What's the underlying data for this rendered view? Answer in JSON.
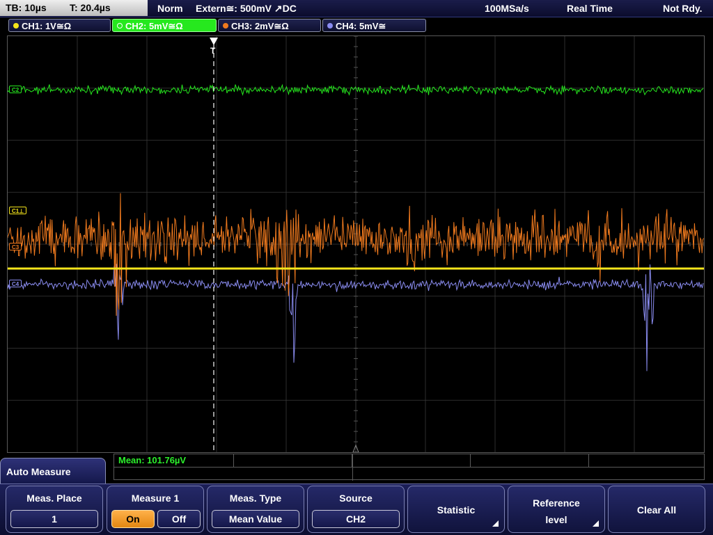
{
  "status": {
    "tb": "TB: 10µs",
    "t": "T: 20.4µs",
    "mode": "Norm",
    "trigger": "Extern≅: 500mV ↗DC",
    "sample_rate": "100MSa/s",
    "acq": "Real Time",
    "state": "Not Rdy."
  },
  "channels": [
    {
      "label": "CH1: 1V≅Ω",
      "color": "#f5e51b"
    },
    {
      "label": "CH2: 5mV≅Ω",
      "color": "#26e81e"
    },
    {
      "label": "CH3: 2mV≅Ω",
      "color": "#f07a1e"
    },
    {
      "label": "CH4: 5mV≅",
      "color": "#8a8cf0"
    }
  ],
  "markers": {
    "c2": "C2",
    "c1": "C1⊥",
    "c3": "C3",
    "c4": "C4",
    "trigger": "T"
  },
  "measurement": {
    "mean": "Mean: 101.76µV"
  },
  "softkeys": {
    "title": "Auto Measure",
    "place_label": "Meas. Place",
    "place_value": "1",
    "measure_label": "Measure 1",
    "on": "On",
    "off": "Off",
    "type_label": "Meas. Type",
    "type_value": "Mean Value",
    "source_label": "Source",
    "source_value": "CH2",
    "statistic": "Statistic",
    "reference_line1": "Reference",
    "reference_line2": "level",
    "clear_all": "Clear All"
  },
  "trace_colors": {
    "ch1": "#f5e51b",
    "ch2": "#26e81e",
    "ch3": "#f07a1e",
    "ch4": "#8a8cf0",
    "grid": "#3a3a3a"
  }
}
